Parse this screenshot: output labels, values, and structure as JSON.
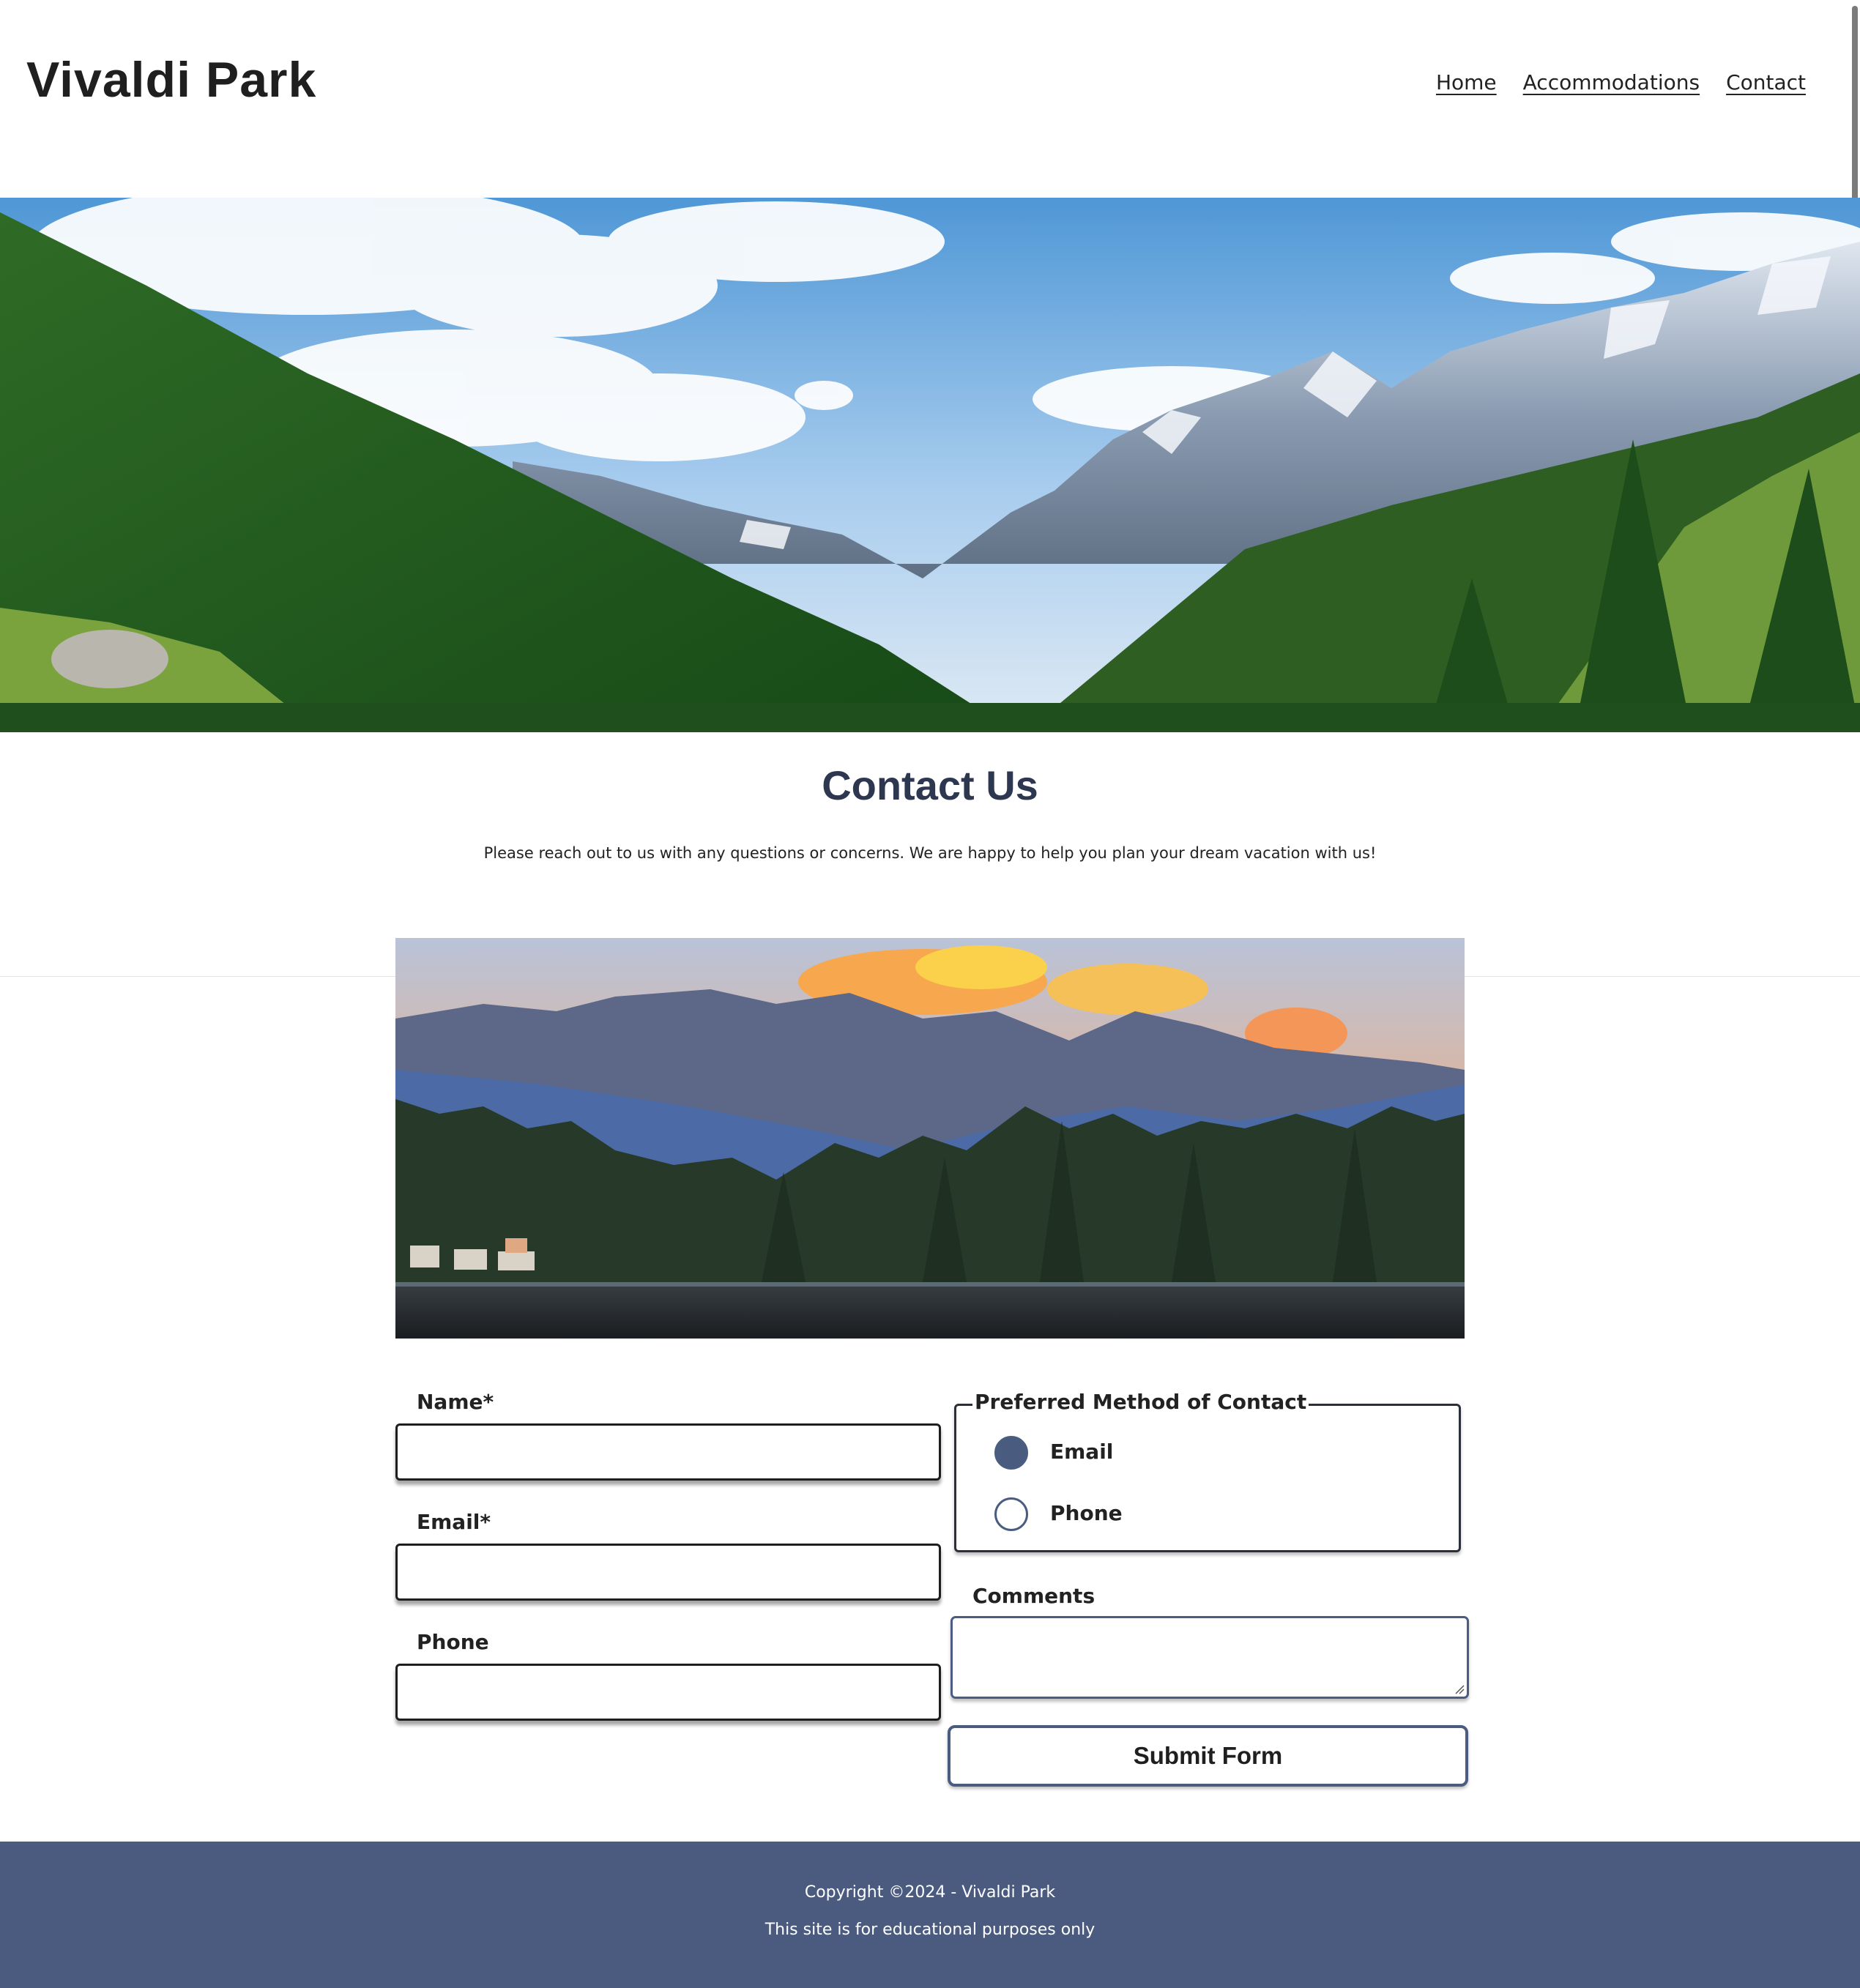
{
  "header": {
    "site_title": "Vivaldi Park",
    "nav": [
      "Home",
      "Accommodations",
      "Contact"
    ]
  },
  "hero": {
    "image": "mountain-valley-hero"
  },
  "main": {
    "heading": "Contact Us",
    "intro": "Please reach out to us with any questions or concerns. We are happy to help you plan your dream vacation with us!",
    "feature_image": "lake-mountain-sunset"
  },
  "form": {
    "name_label": "Name*",
    "email_label": "Email*",
    "phone_label": "Phone",
    "name_value": "",
    "email_value": "",
    "phone_value": "",
    "contact_method": {
      "legend": "Preferred Method of Contact",
      "options": [
        {
          "label": "Email",
          "checked": true
        },
        {
          "label": "Phone",
          "checked": false
        }
      ]
    },
    "comments_label": "Comments",
    "comments_value": "",
    "submit_label": "Submit Form"
  },
  "footer": {
    "copyright": "Copyright ©2024 - Vivaldi Park",
    "note": "This site is for educational purposes only"
  },
  "colors": {
    "accent": "#4a5b80",
    "heading": "#2d3850",
    "footer_bg": "#4a5b7f"
  }
}
